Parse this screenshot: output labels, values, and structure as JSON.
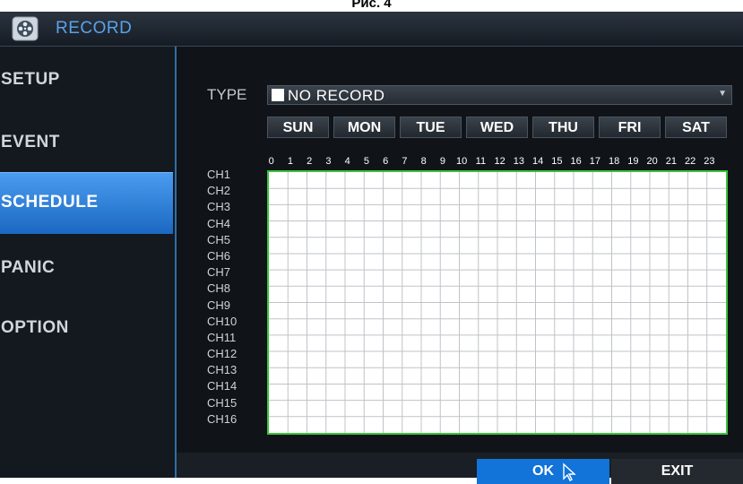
{
  "caption": "Рис. 4",
  "window": {
    "title": "RECORD",
    "icon": "film-reel-icon"
  },
  "sidebar": {
    "items": [
      {
        "label": "SETUP",
        "active": false
      },
      {
        "label": "EVENT",
        "active": false
      },
      {
        "label": "SCHEDULE",
        "active": true
      },
      {
        "label": "PANIC",
        "active": false
      },
      {
        "label": "OPTION",
        "active": false
      }
    ]
  },
  "type": {
    "label": "TYPE",
    "value": "NO RECORD",
    "swatch_color": "#ffffff"
  },
  "days": [
    "SUN",
    "MON",
    "TUE",
    "WED",
    "THU",
    "FRI",
    "SAT"
  ],
  "hours": [
    "0",
    "1",
    "2",
    "3",
    "4",
    "5",
    "6",
    "7",
    "8",
    "9",
    "10",
    "11",
    "12",
    "13",
    "14",
    "15",
    "16",
    "17",
    "18",
    "19",
    "20",
    "21",
    "22",
    "23"
  ],
  "channels": [
    "CH1",
    "CH2",
    "CH3",
    "CH4",
    "CH5",
    "CH6",
    "CH7",
    "CH8",
    "CH9",
    "CH10",
    "CH11",
    "CH12",
    "CH13",
    "CH14",
    "CH15",
    "CH16"
  ],
  "buttons": {
    "ok": "OK",
    "exit": "EXIT"
  },
  "colors": {
    "accent": "#1273d8",
    "grid_border": "#3bc43b",
    "title": "#5aa2ea"
  }
}
